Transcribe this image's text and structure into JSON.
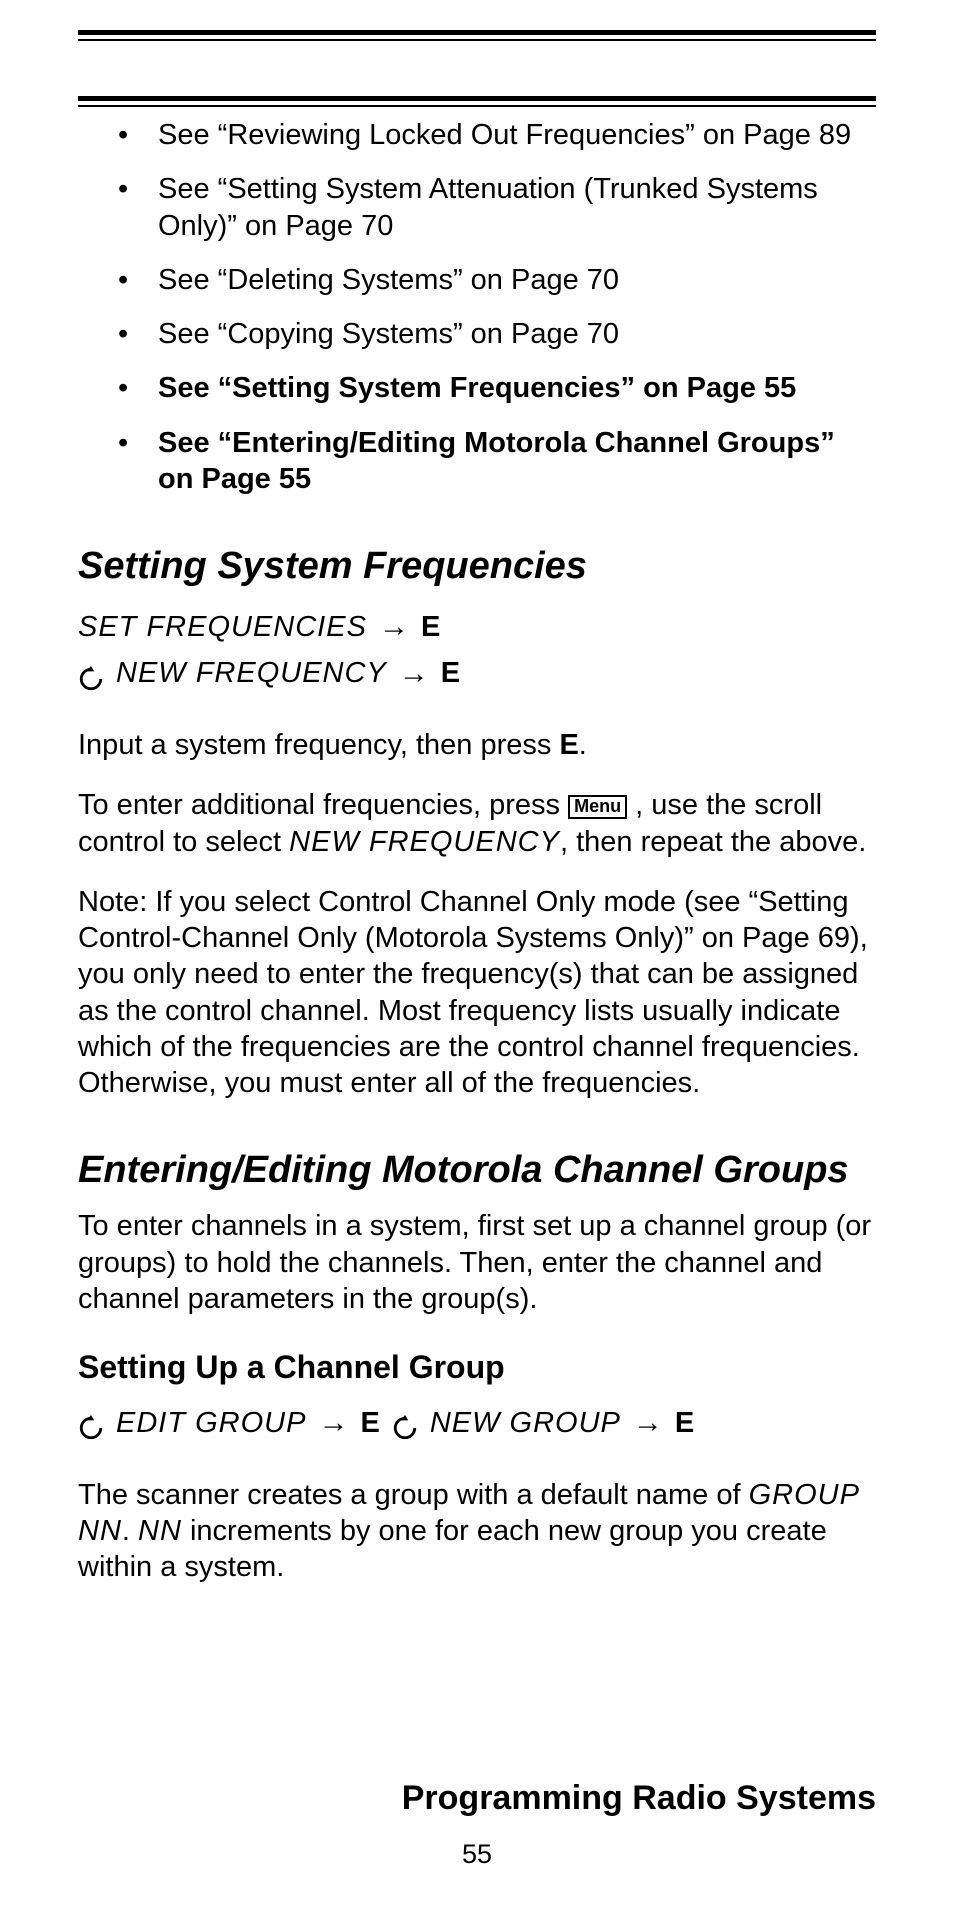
{
  "bullets": [
    {
      "text": "See “Reviewing Locked Out Frequencies” on Page 89",
      "bold": false
    },
    {
      "text": "See “Setting System Attenuation (Trunked Systems Only)” on Page 70",
      "bold": false
    },
    {
      "text": "See “Deleting Systems” on Page 70",
      "bold": false
    },
    {
      "text": "See “Copying Systems” on Page 70",
      "bold": false
    },
    {
      "text": "See “Setting System Frequencies” on Page 55",
      "bold": true
    },
    {
      "text": "See “Entering/Editing Motorola Channel Groups” on Page 55",
      "bold": true
    }
  ],
  "section1": {
    "title": "Setting System Frequencies",
    "seq1_lcd": "Set Frequencies",
    "seq1_key": "E",
    "seq2_lcd": "New Frequency",
    "seq2_key": "E",
    "para1_a": "Input a system frequency, then press ",
    "para1_key": "E",
    "para1_b": ".",
    "para2_a": "To enter additional frequencies, press ",
    "para2_menu": "Menu",
    "para2_b": " , use the scroll control to select ",
    "para2_lcd": "New Frequency",
    "para2_c": ", then repeat the above.",
    "note": "Note: If you select Control Channel Only mode (see “Setting Control-Channel Only (Motorola Systems Only)” on Page 69), you only need to enter the frequency(s) that can be assigned as the control channel. Most frequency lists usually indicate which of the frequencies are the control channel frequencies. Otherwise, you must enter all of the frequencies."
  },
  "section2": {
    "title": "Entering/Editing Motorola Channel Groups",
    "intro": "To enter channels in a system, first set up a channel group (or groups) to hold the channels. Then, enter the channel and channel parameters in the group(s).",
    "sub_title": "Setting Up a Channel Group",
    "seq_lcd1": "Edit Group",
    "seq_key1": "E",
    "seq_lcd2": "New Group",
    "seq_key2": "E",
    "tail_a": "The scanner creates a group with a default name of ",
    "tail_lcd1": "Group nn",
    "tail_b": ". ",
    "tail_lcd2": "nn",
    "tail_c": " increments by one for each new group you create within a system."
  },
  "footer": "Programming Radio Systems",
  "page_number": "55"
}
